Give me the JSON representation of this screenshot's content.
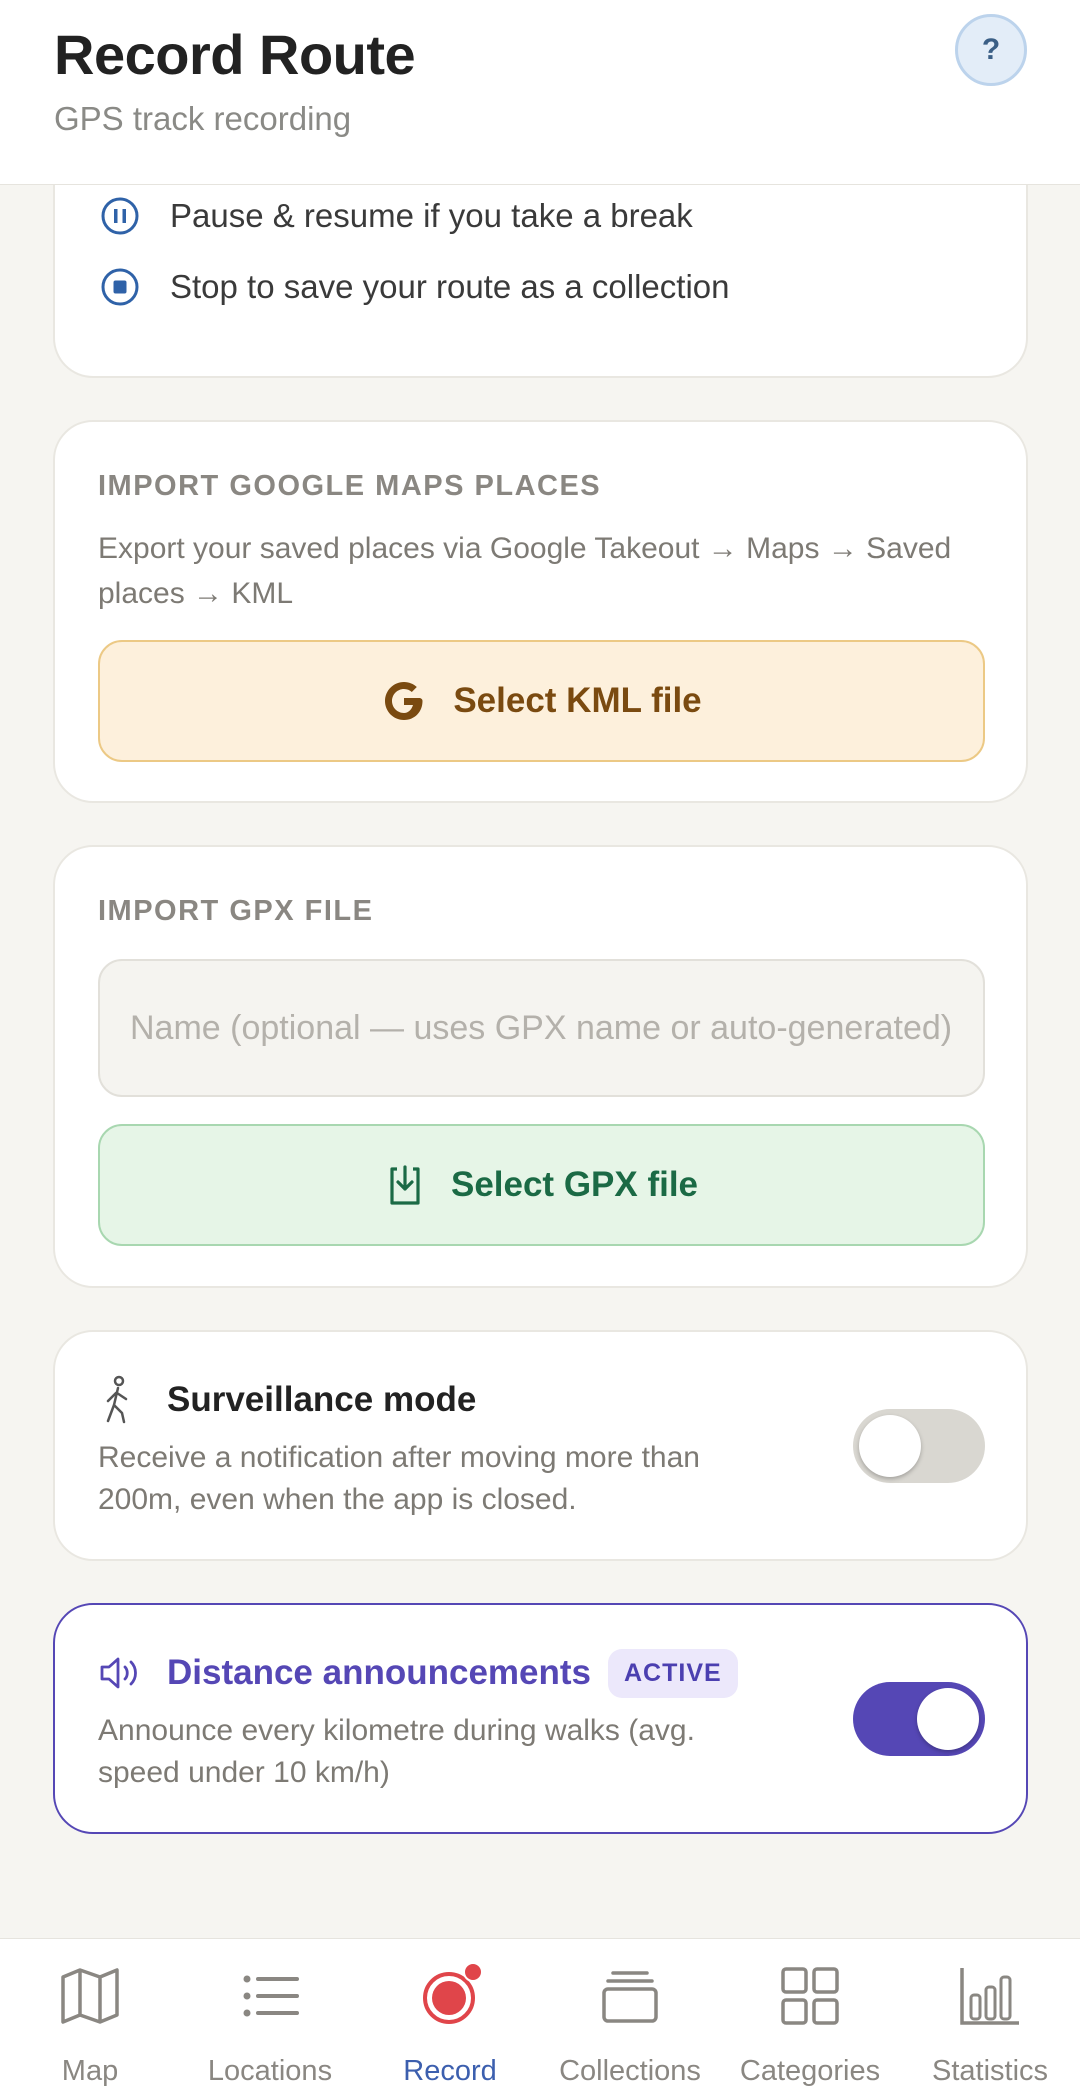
{
  "header": {
    "title": "Record Route",
    "subtitle": "GPS track recording",
    "help_label": "?"
  },
  "steps": [
    {
      "icon": "pause-circle-icon",
      "text": "Pause & resume if you take a break"
    },
    {
      "icon": "stop-circle-icon",
      "text": "Stop to save your route as a collection"
    }
  ],
  "google_import": {
    "label": "IMPORT GOOGLE MAPS PLACES",
    "description": "Export your saved places via Google Takeout → Maps → Saved places → KML",
    "button_label": "Select KML file",
    "button_icon": "google-g-icon"
  },
  "gpx_import": {
    "label": "IMPORT GPX FILE",
    "name_placeholder": "Name (optional — uses GPX name or auto-generated)",
    "name_value": "",
    "button_label": "Select GPX file",
    "button_icon": "file-download-icon"
  },
  "surveillance": {
    "title": "Surveillance mode",
    "description": "Receive a notification after moving more than 200m, even when the app is closed.",
    "enabled": false,
    "icon": "walking-person-icon"
  },
  "announcements": {
    "title": "Distance announcements",
    "badge": "ACTIVE",
    "description": "Announce every kilometre during walks (avg. speed under 10 km/h)",
    "enabled": true,
    "icon": "speaker-icon"
  },
  "nav": {
    "items": [
      {
        "label": "Map",
        "icon": "map-icon",
        "active": false
      },
      {
        "label": "Locations",
        "icon": "list-icon",
        "active": false
      },
      {
        "label": "Record",
        "icon": "record-icon",
        "active": true
      },
      {
        "label": "Collections",
        "icon": "collections-icon",
        "active": false
      },
      {
        "label": "Categories",
        "icon": "grid-icon",
        "active": false
      },
      {
        "label": "Statistics",
        "icon": "bar-chart-icon",
        "active": false
      }
    ]
  },
  "colors": {
    "accent": "#5547b5",
    "record_red": "#e0454a",
    "active_nav": "#3c5fae"
  }
}
